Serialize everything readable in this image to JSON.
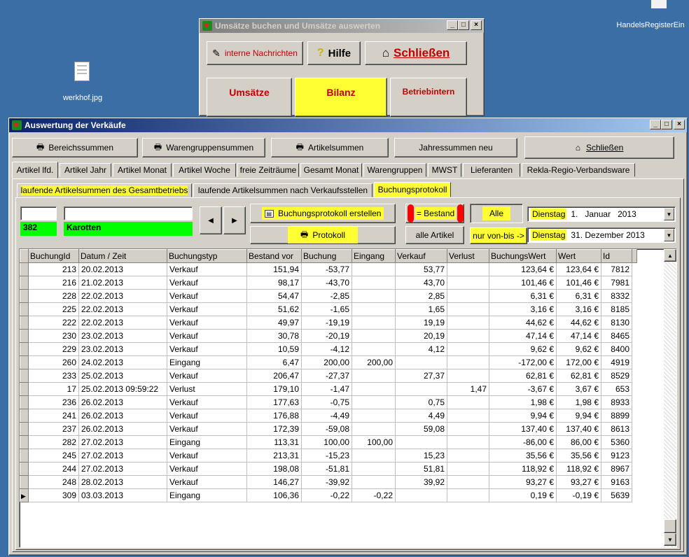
{
  "desktop": {
    "icon_label": "werkhof.jpg",
    "right_label": "HandelsRegisterEin"
  },
  "bg_window": {
    "title": "Umsätze buchen und Umsätze auswerten",
    "nachrichten": "interne Nachrichten",
    "hilfe": "Hilfe",
    "schliessen": "Schließen",
    "btn_umsaetze": "Umsätze",
    "btn_bilanz": "Bilanz",
    "btn_betrieb": "Betriebintern"
  },
  "main": {
    "title": "Auswertung der Verkäufe",
    "toolbar": {
      "bereich": "Bereichssummen",
      "warengruppe": "Warengruppensummen",
      "artikel": "Artikelsummen",
      "jahres": "Jahressummen neu",
      "schliessen": "Schließen"
    },
    "tabs": [
      "Artikel lfd.",
      "Artikel Jahr",
      "Artikel Monat",
      "Artikel Woche",
      "freie Zeiträume",
      "Gesamt Monat",
      "Warengruppen",
      "MWST",
      "Lieferanten",
      "Rekla-Regio-Verbandsware"
    ],
    "subtabs": [
      "laufende Artikelsummen des Gesamtbetriebs",
      "laufende Artikelsummen nach Verkaufsstellen",
      "Buchungsprotokoll"
    ],
    "filter": {
      "article_id": "382",
      "article_name": "Karotten",
      "protokoll_erstellen": "Buchungsprotokoll erstellen",
      "protokoll": "Protokoll",
      "bestand": "= Bestand",
      "alle": "Alle",
      "alle_artikel": "alle Artikel",
      "von_bis": "nur von-bis ->",
      "date_from": {
        "weekday": "Dienstag",
        "rest": "1.   Januar   2013"
      },
      "date_to": {
        "weekday": "Dienstag",
        "rest": "31. Dezember 2013"
      }
    },
    "table": {
      "columns": [
        "BuchungId",
        "Datum / Zeit",
        "Buchungstyp",
        "Bestand vor",
        "Buchung",
        "Eingang",
        "Verkauf",
        "Verlust",
        "BuchungsWert",
        "Wert",
        "Id"
      ],
      "rows": [
        [
          "213",
          "20.02.2013",
          "Verkauf",
          "151,94",
          "-53,77",
          "",
          "53,77",
          "",
          "123,64 €",
          "123,64 €",
          "7812"
        ],
        [
          "216",
          "21.02.2013",
          "Verkauf",
          "98,17",
          "-43,70",
          "",
          "43,70",
          "",
          "101,46 €",
          "101,46 €",
          "7981"
        ],
        [
          "228",
          "22.02.2013",
          "Verkauf",
          "54,47",
          "-2,85",
          "",
          "2,85",
          "",
          "6,31 €",
          "6,31 €",
          "8332"
        ],
        [
          "225",
          "22.02.2013",
          "Verkauf",
          "51,62",
          "-1,65",
          "",
          "1,65",
          "",
          "3,16 €",
          "3,16 €",
          "8185"
        ],
        [
          "222",
          "22.02.2013",
          "Verkauf",
          "49,97",
          "-19,19",
          "",
          "19,19",
          "",
          "44,62 €",
          "44,62 €",
          "8130"
        ],
        [
          "230",
          "23.02.2013",
          "Verkauf",
          "30,78",
          "-20,19",
          "",
          "20,19",
          "",
          "47,14 €",
          "47,14 €",
          "8465"
        ],
        [
          "229",
          "23.02.2013",
          "Verkauf",
          "10,59",
          "-4,12",
          "",
          "4,12",
          "",
          "9,62 €",
          "9,62 €",
          "8400"
        ],
        [
          "260",
          "24.02.2013",
          "Eingang",
          "6,47",
          "200,00",
          "200,00",
          "",
          "",
          "-172,00 €",
          "172,00 €",
          "4919"
        ],
        [
          "233",
          "25.02.2013",
          "Verkauf",
          "206,47",
          "-27,37",
          "",
          "27,37",
          "",
          "62,81 €",
          "62,81 €",
          "8529"
        ],
        [
          "17",
          "25.02.2013 09:59:22",
          "Verlust",
          "179,10",
          "-1,47",
          "",
          "",
          "1,47",
          "-3,67 €",
          "3,67 €",
          "653"
        ],
        [
          "236",
          "26.02.2013",
          "Verkauf",
          "177,63",
          "-0,75",
          "",
          "0,75",
          "",
          "1,98 €",
          "1,98 €",
          "8933"
        ],
        [
          "241",
          "26.02.2013",
          "Verkauf",
          "176,88",
          "-4,49",
          "",
          "4,49",
          "",
          "9,94 €",
          "9,94 €",
          "8899"
        ],
        [
          "237",
          "26.02.2013",
          "Verkauf",
          "172,39",
          "-59,08",
          "",
          "59,08",
          "",
          "137,40 €",
          "137,40 €",
          "8613"
        ],
        [
          "282",
          "27.02.2013",
          "Eingang",
          "113,31",
          "100,00",
          "100,00",
          "",
          "",
          "-86,00 €",
          "86,00 €",
          "5360"
        ],
        [
          "245",
          "27.02.2013",
          "Verkauf",
          "213,31",
          "-15,23",
          "",
          "15,23",
          "",
          "35,56 €",
          "35,56 €",
          "9123"
        ],
        [
          "244",
          "27.02.2013",
          "Verkauf",
          "198,08",
          "-51,81",
          "",
          "51,81",
          "",
          "118,92 €",
          "118,92 €",
          "8967"
        ],
        [
          "248",
          "28.02.2013",
          "Verkauf",
          "146,27",
          "-39,92",
          "",
          "39,92",
          "",
          "93,27 €",
          "93,27 €",
          "9163"
        ],
        [
          "309",
          "03.03.2013",
          "Eingang",
          "106,36",
          "-0,22",
          "-0,22",
          "",
          "",
          "0,19 €",
          "-0,19 €",
          "5639"
        ]
      ]
    }
  }
}
